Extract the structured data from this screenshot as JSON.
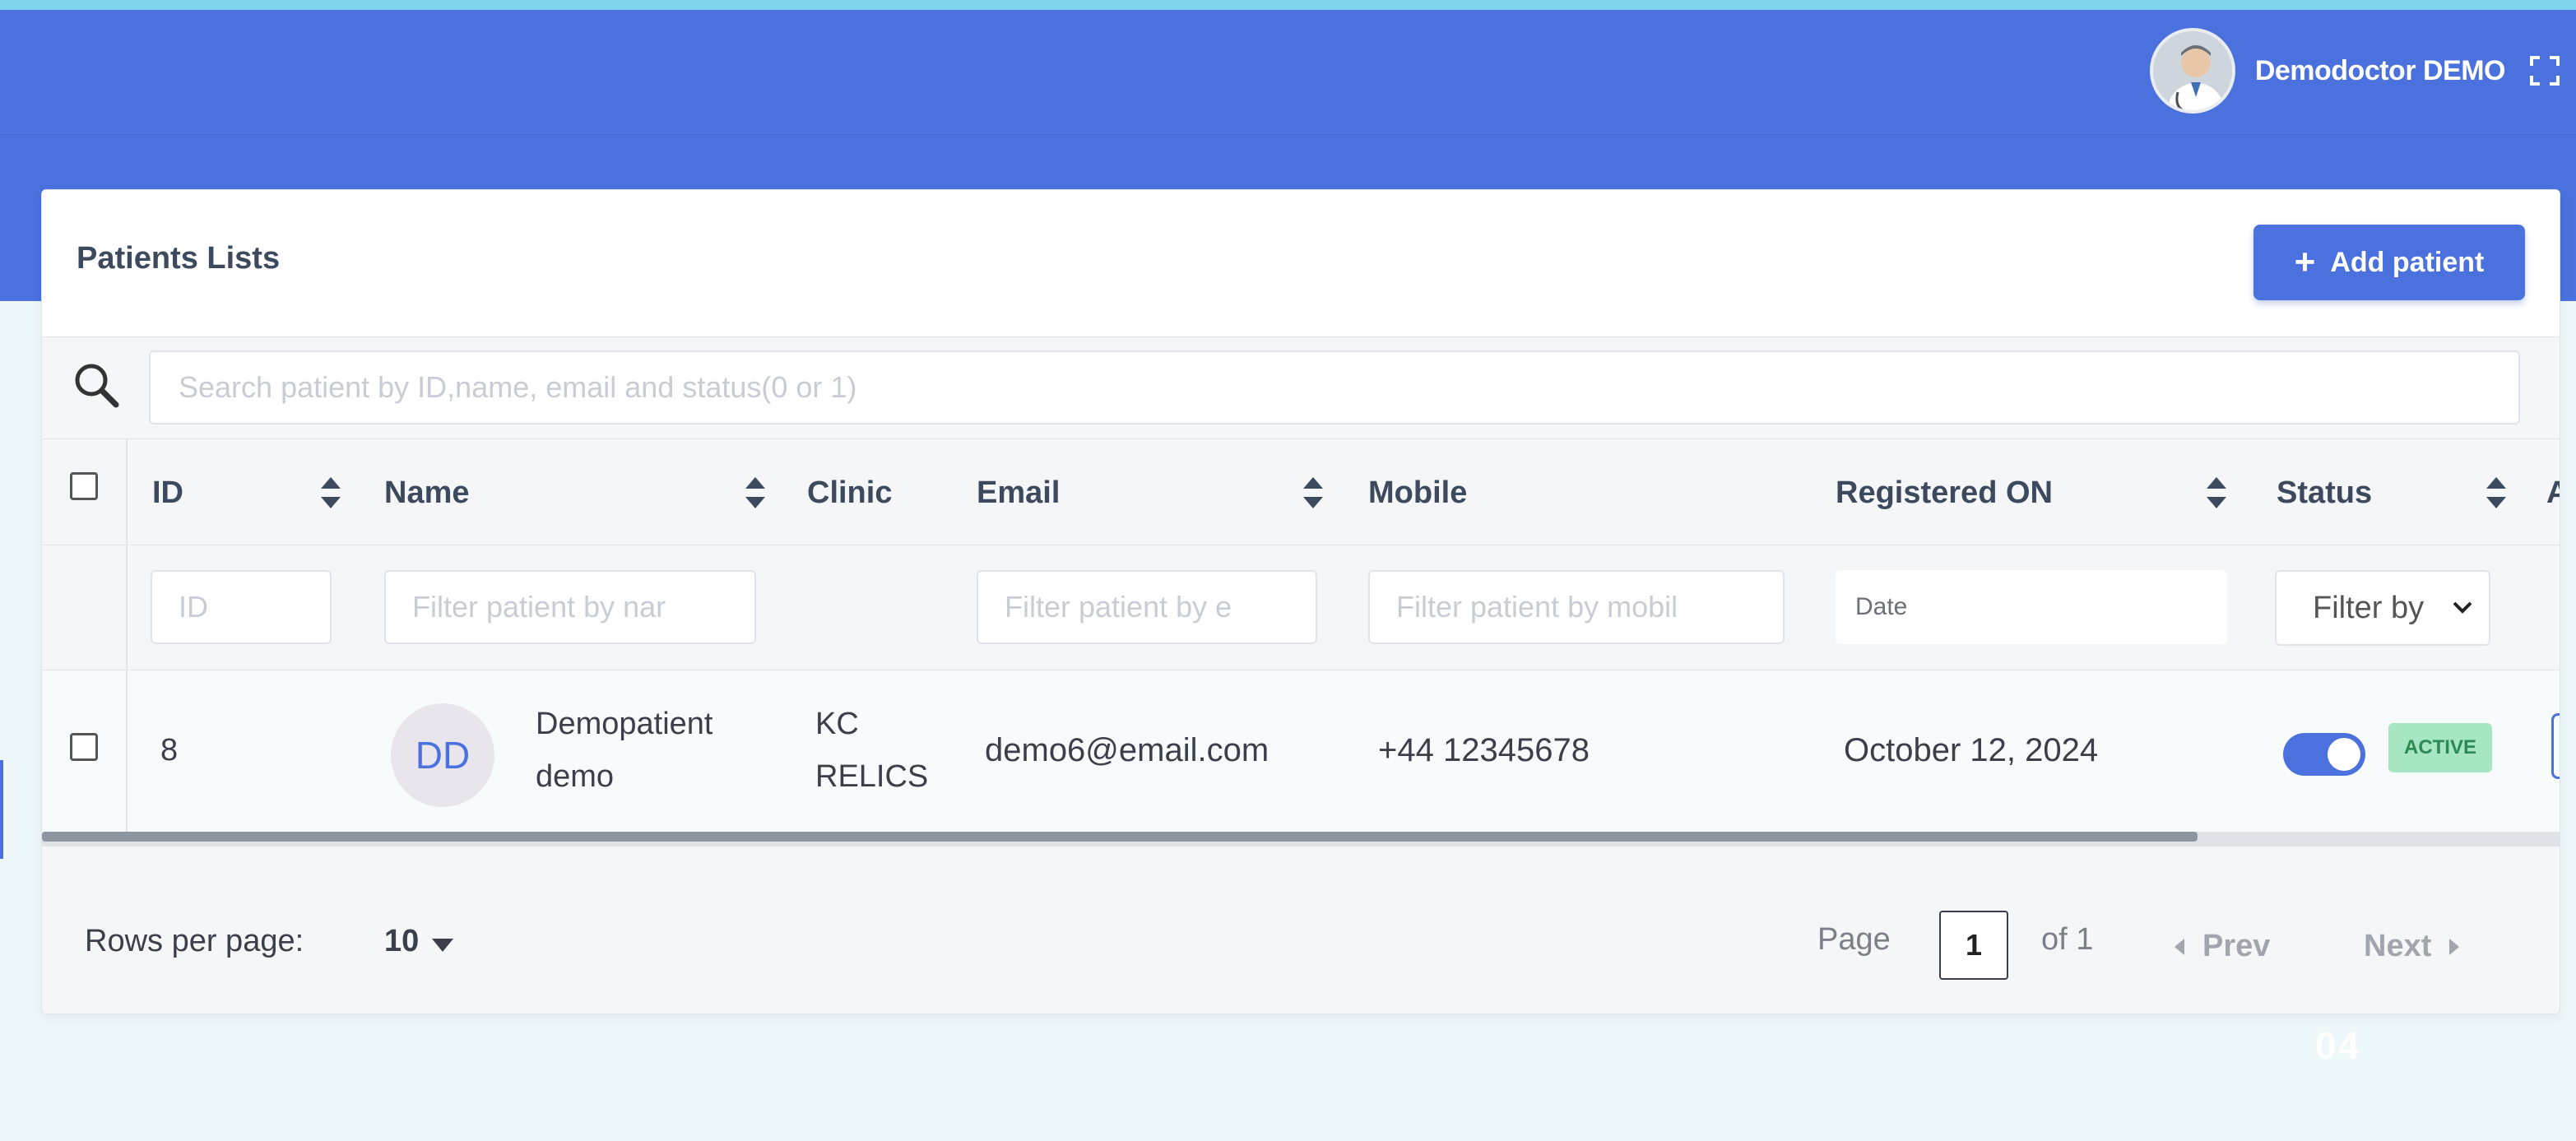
{
  "header": {
    "user_name": "Demodoctor DEMO"
  },
  "card": {
    "title": "Patients Lists",
    "add_button_label": "Add patient"
  },
  "search": {
    "placeholder": "Search patient by ID,name, email and status(0 or 1)"
  },
  "table": {
    "columns": [
      "ID",
      "Name",
      "Clinic",
      "Email",
      "Mobile",
      "Registered ON",
      "Status",
      "A"
    ],
    "filters": {
      "id_placeholder": "ID",
      "name_placeholder": "Filter patient by nar",
      "email_placeholder": "Filter patient by e",
      "mobile_placeholder": "Filter patient by mobil",
      "date_placeholder": "Date",
      "status_select": "Filter by"
    },
    "rows": [
      {
        "id": "8",
        "initials": "DD",
        "name_line1": "Demopatient",
        "name_line2": "demo",
        "clinic_line1": "KC",
        "clinic_line2": "RELICS",
        "email": "demo6@email.com",
        "mobile": "+44 12345678",
        "registered_on": "October 12, 2024",
        "status_enabled": true,
        "status_badge": "ACTIVE"
      }
    ]
  },
  "pagination": {
    "rows_per_page_label": "Rows per page:",
    "rows_per_page_value": "10",
    "page_label": "Page",
    "current_page": "1",
    "of_label": "of 1",
    "prev_label": "Prev",
    "next_label": "Next"
  },
  "overlay": {
    "corner_number": "04"
  },
  "colors": {
    "primary": "#4a71dd",
    "active_badge_bg": "#a6e6c2",
    "active_badge_text": "#2b8a55"
  }
}
